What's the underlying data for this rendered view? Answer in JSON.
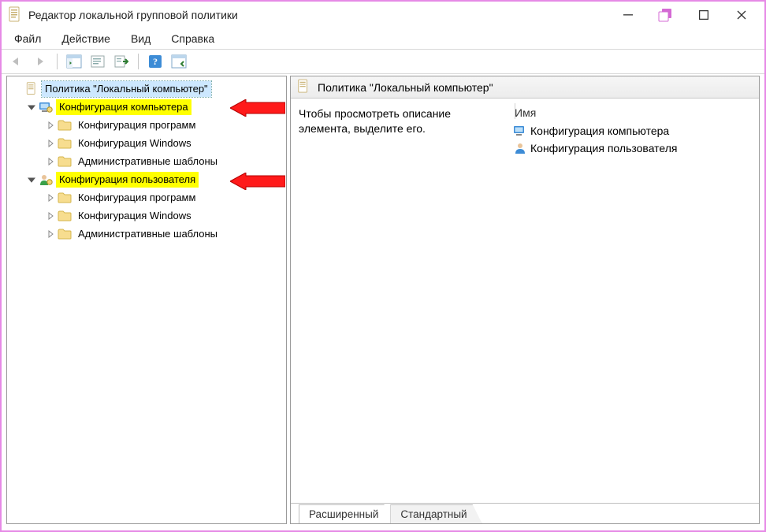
{
  "window": {
    "title": "Редактор локальной групповой политики"
  },
  "menu": {
    "file": "Файл",
    "action": "Действие",
    "view": "Вид",
    "help": "Справка"
  },
  "tree": {
    "root_label": "Политика \"Локальный компьютер\"",
    "computer_config": "Конфигурация компьютера",
    "user_config": "Конфигурация пользователя",
    "software_settings": "Конфигурация программ",
    "windows_settings": "Конфигурация Windows",
    "admin_templates": "Административные шаблоны"
  },
  "right": {
    "header": "Политика \"Локальный компьютер\"",
    "description": "Чтобы просмотреть описание элемента, выделите его.",
    "column_name": "Имя",
    "items": {
      "computer_config": "Конфигурация компьютера",
      "user_config": "Конфигурация пользователя"
    }
  },
  "tabs": {
    "extended": "Расширенный",
    "standard": "Стандартный"
  }
}
